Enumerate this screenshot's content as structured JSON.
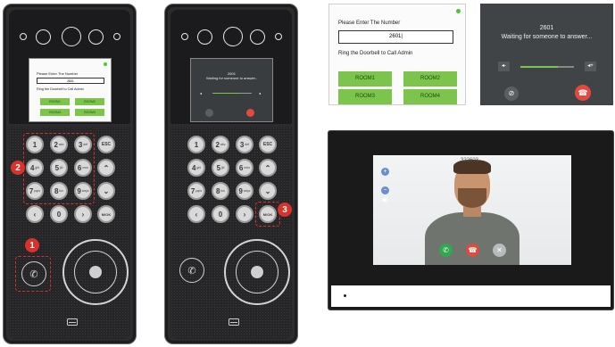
{
  "device1": {
    "screen": {
      "title": "Please Enter The Number",
      "input_value": "2601",
      "hint": "Ring the Doorbell to Call Admin",
      "rooms": [
        "ROOM1",
        "ROOM2",
        "ROOM3",
        "ROOM4"
      ]
    },
    "keys": [
      {
        "main": "1",
        "sub": ""
      },
      {
        "main": "2",
        "sub": "abc"
      },
      {
        "main": "3",
        "sub": "def"
      },
      {
        "main": "ESC",
        "sub": ""
      },
      {
        "main": "4",
        "sub": "ghi"
      },
      {
        "main": "5",
        "sub": "jkl"
      },
      {
        "main": "6",
        "sub": "mno"
      },
      {
        "main": "⌃",
        "sub": ""
      },
      {
        "main": "7",
        "sub": "pqrs"
      },
      {
        "main": "8",
        "sub": "tuv"
      },
      {
        "main": "9",
        "sub": "wxyz"
      },
      {
        "main": "⌄",
        "sub": ""
      },
      {
        "main": "‹",
        "sub": ""
      },
      {
        "main": "0",
        "sub": ""
      },
      {
        "main": "›",
        "sub": ""
      },
      {
        "main": "M/OK",
        "sub": ""
      }
    ],
    "badges": [
      "1",
      "2"
    ]
  },
  "device2": {
    "screen": {
      "room": "2601",
      "status": "Waiting for someone to answer.."
    },
    "badges": [
      "3"
    ]
  },
  "enlarged_input_screen": {
    "title": "Please Enter The Number",
    "input_value": "2601|",
    "hint": "Ring the Doorbell to Call Admin",
    "rooms": [
      "ROOM1",
      "ROOM2",
      "ROOM3",
      "ROOM4"
    ]
  },
  "enlarged_call_screen": {
    "room": "2601",
    "status": "Waiting for someone to answer...",
    "volume_level": 0.7
  },
  "monitor": {
    "room": "322603"
  },
  "colors": {
    "device_body": "#2c2c2e",
    "badge": "#d9322c",
    "room_button": "#7cc44b",
    "hangup": "#e14a3c",
    "answer": "#2fa84f"
  },
  "icons": [
    "phone-icon",
    "mute-mic-icon",
    "hangup-icon",
    "volume-down-icon",
    "volume-up-icon",
    "fingerprint-icon",
    "card-icon",
    "speaker-icon",
    "close-icon"
  ]
}
